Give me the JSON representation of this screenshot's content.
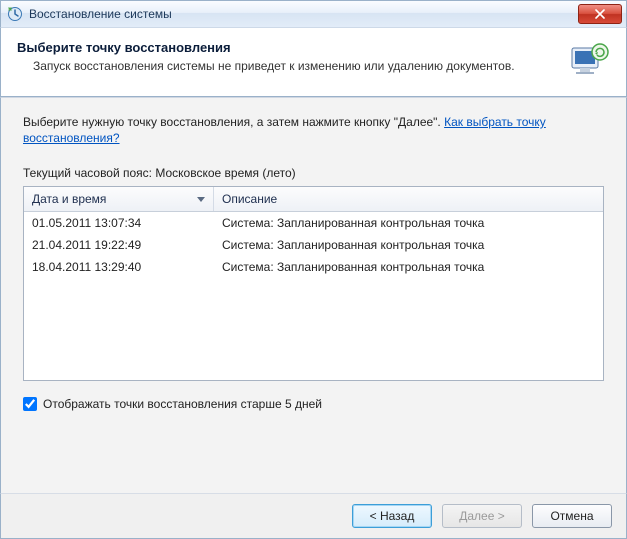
{
  "titlebar": {
    "title": "Восстановление системы"
  },
  "banner": {
    "title": "Выберите точку восстановления",
    "subtitle": "Запуск восстановления системы не приведет к изменению или удалению документов."
  },
  "instruction": {
    "prefix": "Выберите нужную точку восстановления, а затем нажмите кнопку \"Далее\". ",
    "link": "Как выбрать точку восстановления?"
  },
  "timezone_line": "Текущий часовой пояс: Московское время (лето)",
  "table": {
    "headers": {
      "date": "Дата и время",
      "desc": "Описание"
    },
    "rows": [
      {
        "date": "01.05.2011 13:07:34",
        "desc": "Система: Запланированная контрольная точка"
      },
      {
        "date": "21.04.2011 19:22:49",
        "desc": "Система: Запланированная контрольная точка"
      },
      {
        "date": "18.04.2011 13:29:40",
        "desc": "Система: Запланированная контрольная точка"
      }
    ]
  },
  "checkbox": {
    "label": "Отображать точки восстановления старше 5 дней",
    "checked": true
  },
  "buttons": {
    "back": "< Назад",
    "next": "Далее >",
    "cancel": "Отмена"
  }
}
